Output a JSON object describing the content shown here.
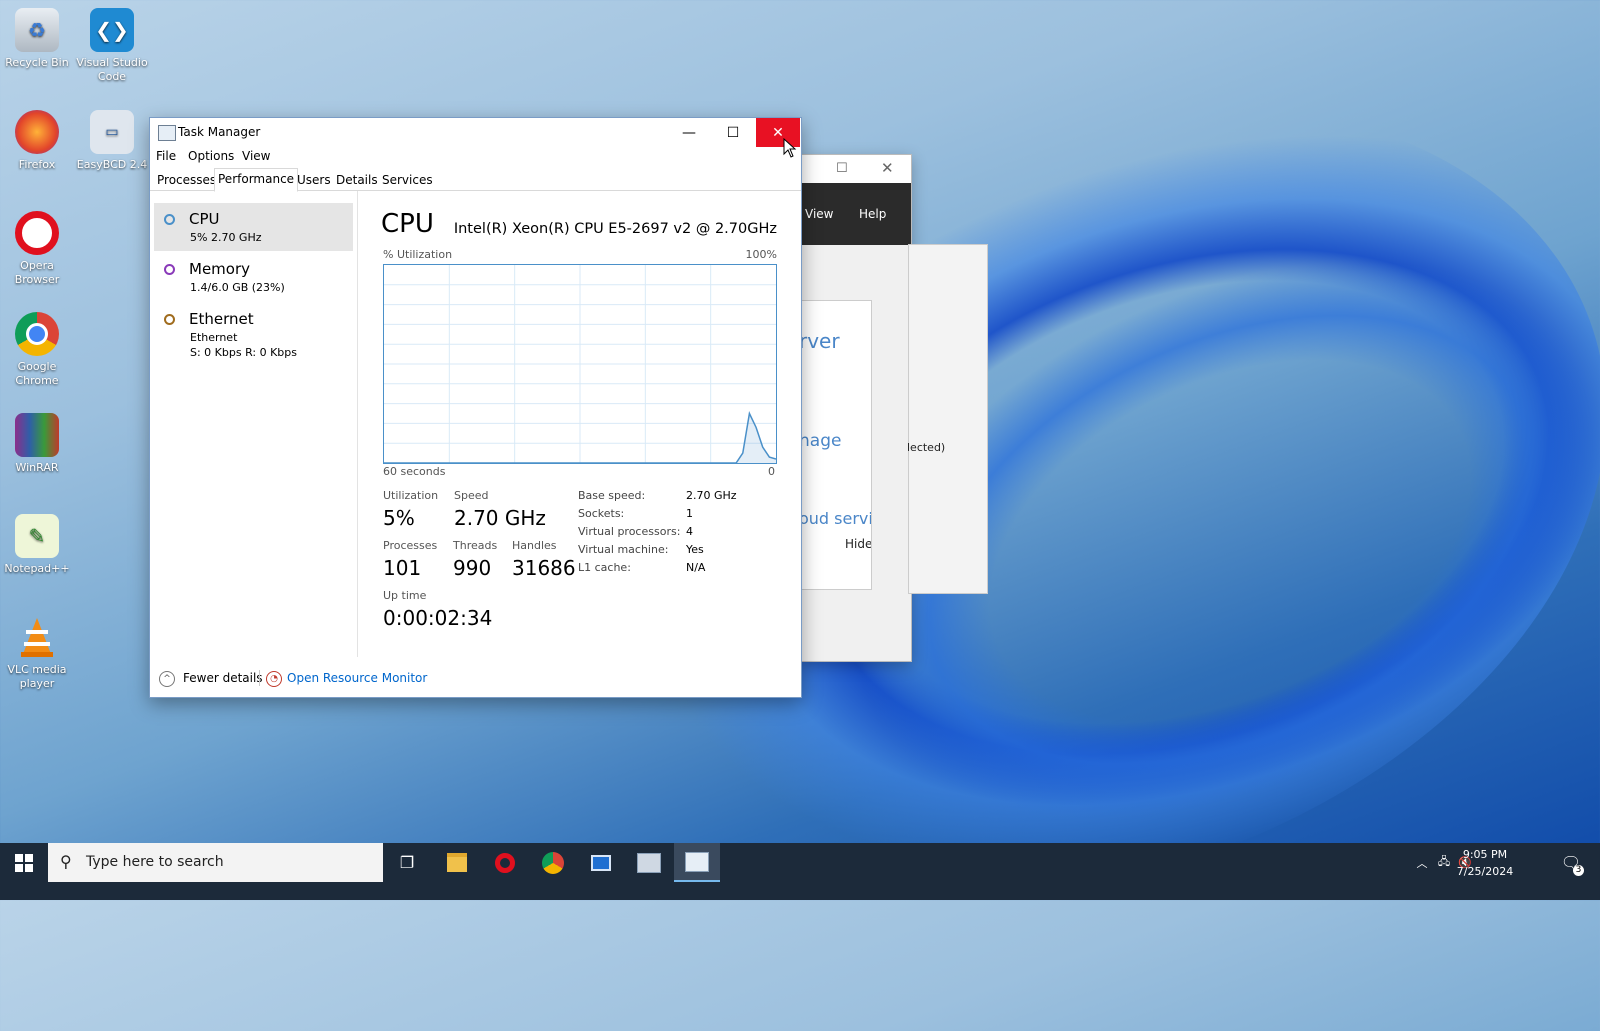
{
  "colors": {
    "close_red": "#e81123",
    "accent_blue": "#4a90c9",
    "taskbar": "#1c2a3a",
    "cpu_ring": "#4a90c9",
    "memory_ring": "#8a3ab9",
    "ethernet_ring": "#a06c1e",
    "link_blue": "#0066cc"
  },
  "desktop": {
    "icons": [
      {
        "label": "Recycle Bin",
        "icon": "recycle-bin-icon"
      },
      {
        "label": "Visual Studio Code",
        "icon": "vscode-icon"
      },
      {
        "label": "Firefox",
        "icon": "firefox-icon"
      },
      {
        "label": "EasyBCD 2.4",
        "icon": "easybcd-icon"
      },
      {
        "label": "Opera Browser",
        "icon": "opera-icon"
      },
      {
        "label": "Google Chrome",
        "icon": "chrome-icon"
      },
      {
        "label": "WinRAR",
        "icon": "winrar-icon"
      },
      {
        "label": "Notepad++",
        "icon": "notepadpp-icon"
      },
      {
        "label": "VLC media player",
        "icon": "vlc-icon"
      }
    ]
  },
  "background_window": {
    "menu": [
      "View",
      "Help"
    ],
    "fragments": [
      "rver",
      "nage",
      "oud servic",
      "Hide",
      "lected)"
    ]
  },
  "task_manager": {
    "title": "Task Manager",
    "menu": [
      "File",
      "Options",
      "View"
    ],
    "tabs": [
      "Processes",
      "Performance",
      "Users",
      "Details",
      "Services"
    ],
    "active_tab": "Performance",
    "sidebar": [
      {
        "name": "CPU",
        "sub": "5% 2.70 GHz",
        "selected": true
      },
      {
        "name": "Memory",
        "sub": "1.4/6.0 GB (23%)",
        "selected": false
      },
      {
        "name": "Ethernet",
        "sub": "Ethernet",
        "sub2": "S: 0 Kbps R: 0 Kbps",
        "selected": false
      }
    ],
    "cpu": {
      "heading": "CPU",
      "model": "Intel(R) Xeon(R) CPU E5-2697 v2 @ 2.70GHz",
      "graph_label": "% Utilization",
      "graph_max": "100%",
      "graph_time": "60 seconds",
      "graph_zero": "0",
      "utilization_history_percent": [
        0,
        0,
        0,
        0,
        0,
        0,
        0,
        0,
        0,
        0,
        0,
        0,
        0,
        0,
        0,
        0,
        0,
        0,
        0,
        0,
        0,
        0,
        0,
        0,
        0,
        0,
        0,
        0,
        0,
        0,
        0,
        0,
        0,
        0,
        0,
        0,
        0,
        0,
        0,
        0,
        0,
        0,
        0,
        0,
        0,
        0,
        0,
        0,
        0,
        0,
        0,
        0,
        0,
        0,
        5,
        25,
        18,
        8,
        3,
        2
      ],
      "stats": {
        "utilization": {
          "label": "Utilization",
          "value": "5%"
        },
        "speed": {
          "label": "Speed",
          "value": "2.70 GHz"
        },
        "processes": {
          "label": "Processes",
          "value": "101"
        },
        "threads": {
          "label": "Threads",
          "value": "990"
        },
        "handles": {
          "label": "Handles",
          "value": "31686"
        },
        "uptime": {
          "label": "Up time",
          "value": "0:00:02:34"
        }
      },
      "details": [
        {
          "key": "Base speed:",
          "value": "2.70 GHz"
        },
        {
          "key": "Sockets:",
          "value": "1"
        },
        {
          "key": "Virtual processors:",
          "value": "4"
        },
        {
          "key": "Virtual machine:",
          "value": "Yes"
        },
        {
          "key": "L1 cache:",
          "value": "N/A"
        }
      ]
    },
    "footer": {
      "fewer_details": "Fewer details",
      "open_resource_monitor": "Open Resource Monitor"
    }
  },
  "taskbar": {
    "search_placeholder": "Type here to search",
    "time": "9:05 PM",
    "date": "7/25/2024",
    "notifications": "3",
    "apps": [
      "task-view-icon",
      "file-explorer-icon",
      "opera-icon",
      "chrome-icon",
      "window-app-icon",
      "network-app-icon",
      "task-manager-icon"
    ]
  }
}
